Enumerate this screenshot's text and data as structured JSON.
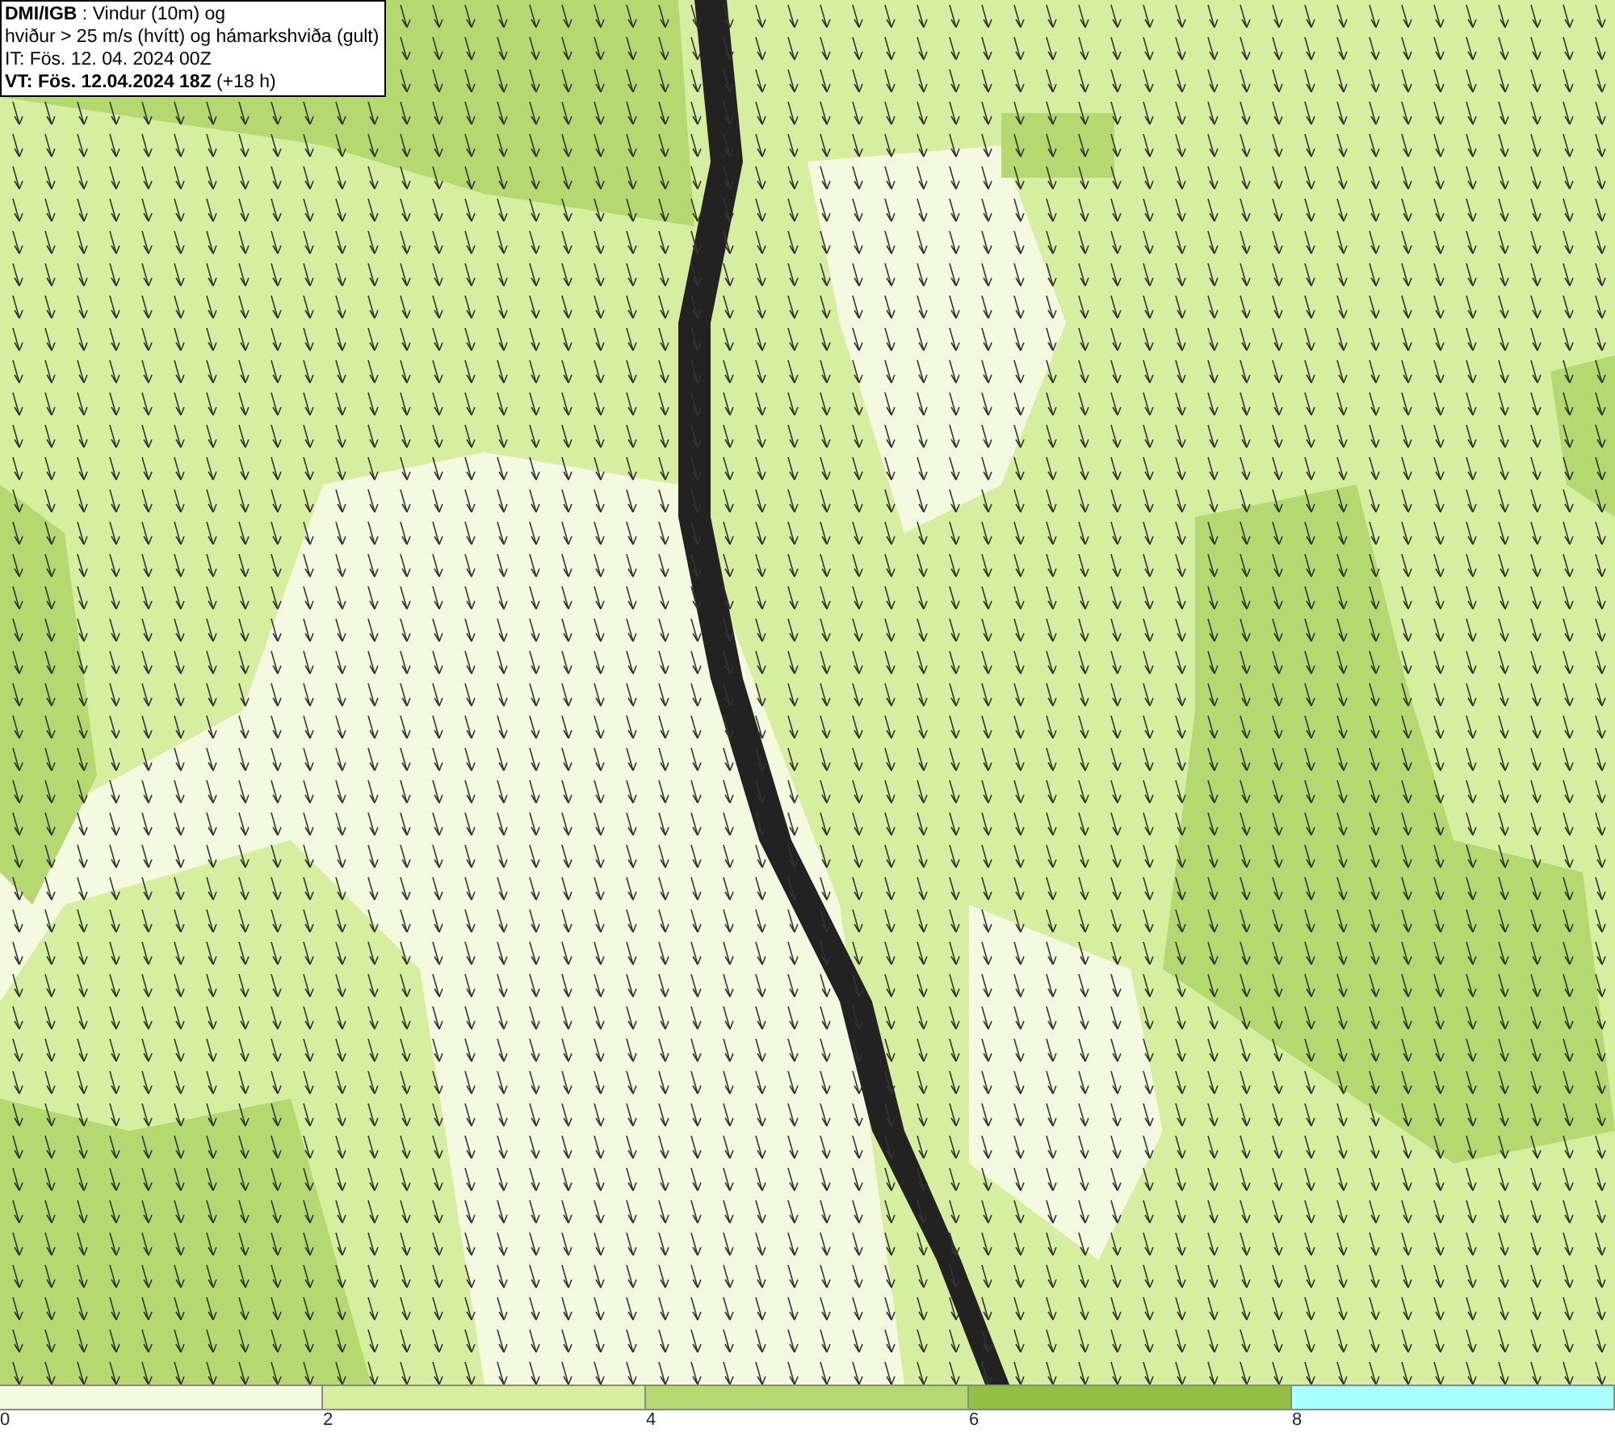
{
  "legend": {
    "lines": [
      "**DMI/IGB** : Vindur (10m) og",
      "hviður > 25 m/s (hvítt) og hámarkshviða (gult)",
      "IT: Fös. 12. 04. 2024 00Z",
      "**VT: Fös. 12.04.2024 18Z** (+18 h)"
    ]
  },
  "scale": {
    "bins": [
      {
        "color": "#f4fae0"
      },
      {
        "color": "#d6eea0"
      },
      {
        "color": "#b5d970"
      },
      {
        "color": "#93bf45"
      },
      {
        "color": "#aaffff"
      }
    ],
    "ticks": [
      "0",
      "2",
      "4",
      "6",
      "8"
    ]
  }
}
